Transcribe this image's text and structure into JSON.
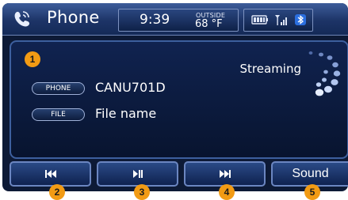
{
  "header": {
    "title": "Phone",
    "time": "9:39",
    "outside_label": "OUTSIDE",
    "outside_temp": "68 °F",
    "status_icons": [
      "battery-icon",
      "signal-icon",
      "bluetooth-icon"
    ]
  },
  "main": {
    "badge": "1",
    "streaming_label": "Streaming",
    "rows": [
      {
        "tag": "PHONE",
        "value": "CANU701D"
      },
      {
        "tag": "FILE",
        "value": "File name"
      }
    ]
  },
  "buttons": [
    {
      "icon": "previous-track-icon",
      "badge": "2"
    },
    {
      "icon": "play-pause-icon",
      "badge": "3"
    },
    {
      "icon": "next-track-icon",
      "badge": "4"
    },
    {
      "label": "Sound",
      "badge": "5"
    }
  ],
  "colors": {
    "screen_bg": "#0d1a36",
    "accent": "#f29b14",
    "border": "#6b86c1",
    "text": "#ffffff"
  }
}
